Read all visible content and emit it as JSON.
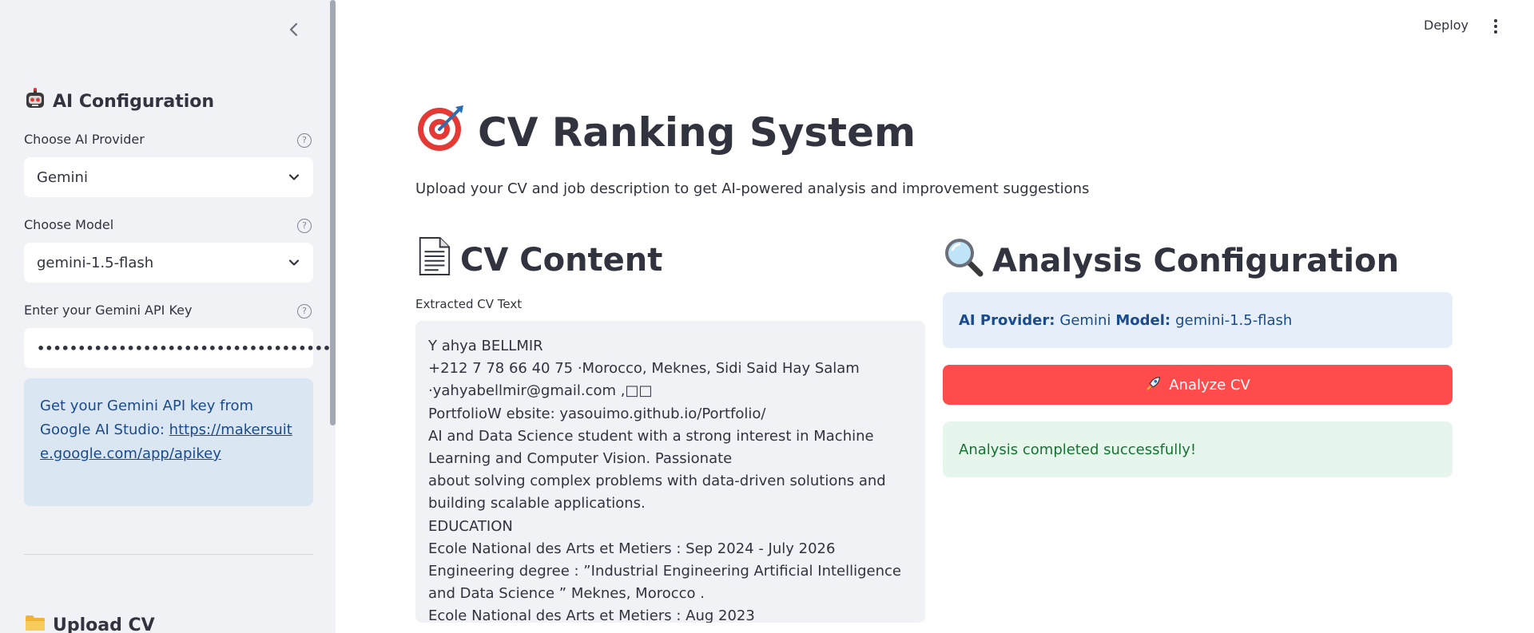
{
  "header": {
    "deploy_label": "Deploy"
  },
  "sidebar": {
    "ai_config_heading": "AI Configuration",
    "provider_label": "Choose AI Provider",
    "provider_value": "Gemini",
    "model_label": "Choose Model",
    "model_value": "gemini-1.5-flash",
    "api_key_label": "Enter your Gemini API Key",
    "api_key_masked": "••••••••••••••••••••••••••••••••••••••",
    "info_text": "Get your Gemini API key from Google AI Studio:",
    "info_link": "https://makersuite.google.com/app/apikey",
    "upload_heading": "Upload CV",
    "help_glyph": "?"
  },
  "main": {
    "title": "CV Ranking System",
    "subtitle": "Upload your CV and job description to get AI-powered analysis and improvement suggestions",
    "cv_section_title": "CV Content",
    "extracted_label": "Extracted CV Text",
    "cv_text": "Y ahya BELLMIR\n+212 7 78 66 40 75 ·Morocco, Meknes, Sidi Said Hay Salam\n·yahyabellmir@gmail.com ,□□\nPortfolioW ebsite: yasouimo.github.io/Portfolio/\nAI and Data Science student with a strong interest in Machine Learning and Computer Vision. Passionate\nabout solving complex problems with data-driven solutions and building scalable applications.\nEDUCATION\nEcole National des Arts et Metiers : Sep 2024 - July 2026\nEngineering degree : ”Industrial Engineering Artificial Intelligence and Data Science ” Meknes, Morocco .\nEcole National des Arts et Metiers : Aug 2023",
    "analysis_section_title": "Analysis Configuration",
    "config": {
      "provider_key": "AI Provider:",
      "provider_value": "Gemini",
      "model_key": "Model:",
      "model_value": "gemini-1.5-flash"
    },
    "analyze_button": "Analyze CV",
    "success_message": "Analysis completed successfully!"
  },
  "icons": {
    "sidebar_collapse": "chevron-left-icon",
    "ai_config": "robot-icon",
    "upload": "folder-icon",
    "title": "target-icon",
    "cv_section": "document-icon",
    "analysis_section": "magnifier-icon",
    "analyze": "rocket-icon",
    "password_toggle": "eye-icon",
    "menu": "kebab-menu-icon"
  },
  "colors": {
    "primary_button": "#ff4b4b",
    "info_bg": "#dbe6f3",
    "success_bg": "#e7f6ec",
    "sidebar_bg": "#f0f2f6"
  }
}
